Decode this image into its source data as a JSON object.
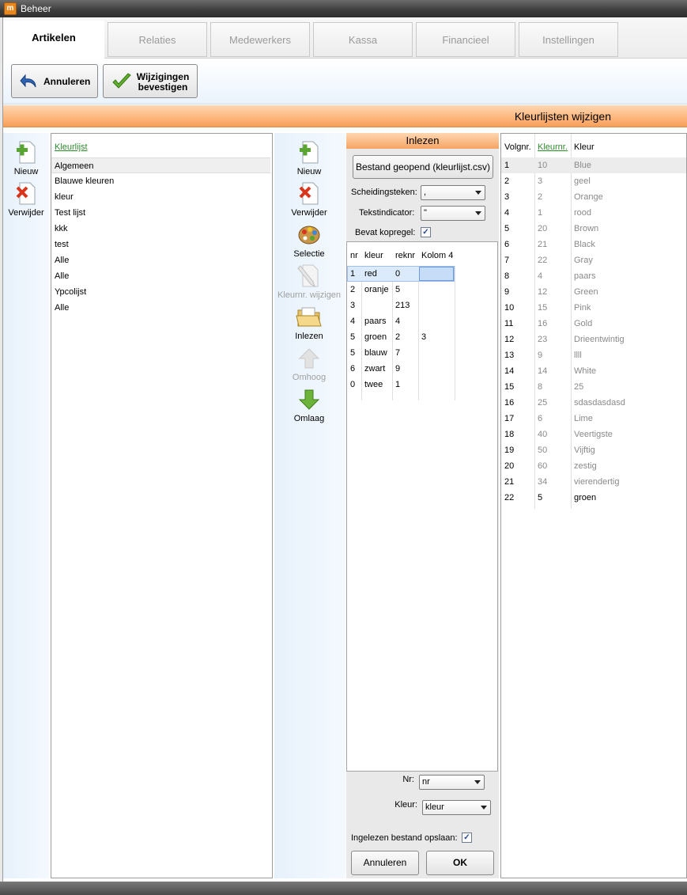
{
  "window": {
    "title": "Beheer",
    "app_icon": "app-logo-icon"
  },
  "tabs": [
    {
      "label": "Artikelen",
      "active": true
    },
    {
      "label": "Relaties",
      "active": false
    },
    {
      "label": "Medewerkers",
      "active": false
    },
    {
      "label": "Kassa",
      "active": false
    },
    {
      "label": "Financieel",
      "active": false
    },
    {
      "label": "Instellingen",
      "active": false
    }
  ],
  "toolbar": {
    "cancel_label": "Annuleren",
    "confirm_line1": "Wijzigingen",
    "confirm_line2": "bevestigen"
  },
  "section_title": "Kleurlijsten wijzigen",
  "left_tools": {
    "new_label": "Nieuw",
    "delete_label": "Verwijder"
  },
  "colorlists": {
    "header": "Kleurlijst",
    "items": [
      "Algemeen",
      "Blauwe kleuren",
      "kleur",
      "Test lijst",
      "kkk",
      "test",
      "Alle",
      "Alle",
      "Ypcolijst",
      "Alle"
    ],
    "selected_index": 0
  },
  "mid_tools": {
    "new_label": "Nieuw",
    "delete_label": "Verwijder",
    "selection_label": "Selectie",
    "edit_colornr_label": "Kleurnr. wijzigen",
    "import_label": "Inlezen",
    "up_label": "Omhoog",
    "down_label": "Omlaag"
  },
  "import": {
    "header": "Inlezen",
    "file_button": "Bestand geopend (kleurlijst.csv)",
    "separator_label": "Scheidingsteken:",
    "separator_value": ",",
    "textindicator_label": "Tekstindicator:",
    "textindicator_value": "\"",
    "headerrow_label": "Bevat kopregel:",
    "headerrow_checked": true,
    "columns": [
      "nr",
      "kleur",
      "reknr",
      "Kolom 4"
    ],
    "rows": [
      [
        "1",
        "red",
        "0",
        ""
      ],
      [
        "2",
        "oranje",
        "5",
        ""
      ],
      [
        "3",
        "",
        "213",
        ""
      ],
      [
        "4",
        "paars",
        "4",
        ""
      ],
      [
        "5",
        "groen",
        "2",
        "3"
      ],
      [
        "5",
        "blauw",
        "7",
        ""
      ],
      [
        "6",
        "zwart",
        "9",
        ""
      ],
      [
        "0",
        "twee",
        "1",
        ""
      ]
    ],
    "nr_label": "Nr:",
    "nr_value": "nr",
    "kleur_label": "Kleur:",
    "kleur_value": "kleur",
    "save_label": "Ingelezen bestand opslaan:",
    "save_checked": true,
    "cancel_label": "Annuleren",
    "ok_label": "OK"
  },
  "colors_table": {
    "columns": [
      "Volgnr.",
      "Kleurnr.",
      "Kleur"
    ],
    "rows": [
      [
        "1",
        "10",
        "Blue"
      ],
      [
        "2",
        "3",
        "geel"
      ],
      [
        "3",
        "2",
        "Orange"
      ],
      [
        "4",
        "1",
        "rood"
      ],
      [
        "5",
        "20",
        "Brown"
      ],
      [
        "6",
        "21",
        "Black"
      ],
      [
        "7",
        "22",
        "Gray"
      ],
      [
        "8",
        "4",
        "paars"
      ],
      [
        "9",
        "12",
        "Green"
      ],
      [
        "10",
        "15",
        "Pink"
      ],
      [
        "11",
        "16",
        "Gold"
      ],
      [
        "12",
        "23",
        "Drieentwintig"
      ],
      [
        "13",
        "9",
        "llll"
      ],
      [
        "14",
        "14",
        "White"
      ],
      [
        "15",
        "8",
        "25"
      ],
      [
        "16",
        "25",
        "sdasdasdasd"
      ],
      [
        "17",
        "6",
        "Lime"
      ],
      [
        "18",
        "40",
        "Veertigste"
      ],
      [
        "19",
        "50",
        "Vijftig"
      ],
      [
        "20",
        "60",
        "zestig"
      ],
      [
        "21",
        "34",
        "vierendertig"
      ],
      [
        "22",
        "5",
        "groen"
      ]
    ]
  },
  "colors": {
    "accent_orange": "#f49e58",
    "link_green": "#2e8b2e",
    "selection_blue": "#c7dcf7"
  }
}
